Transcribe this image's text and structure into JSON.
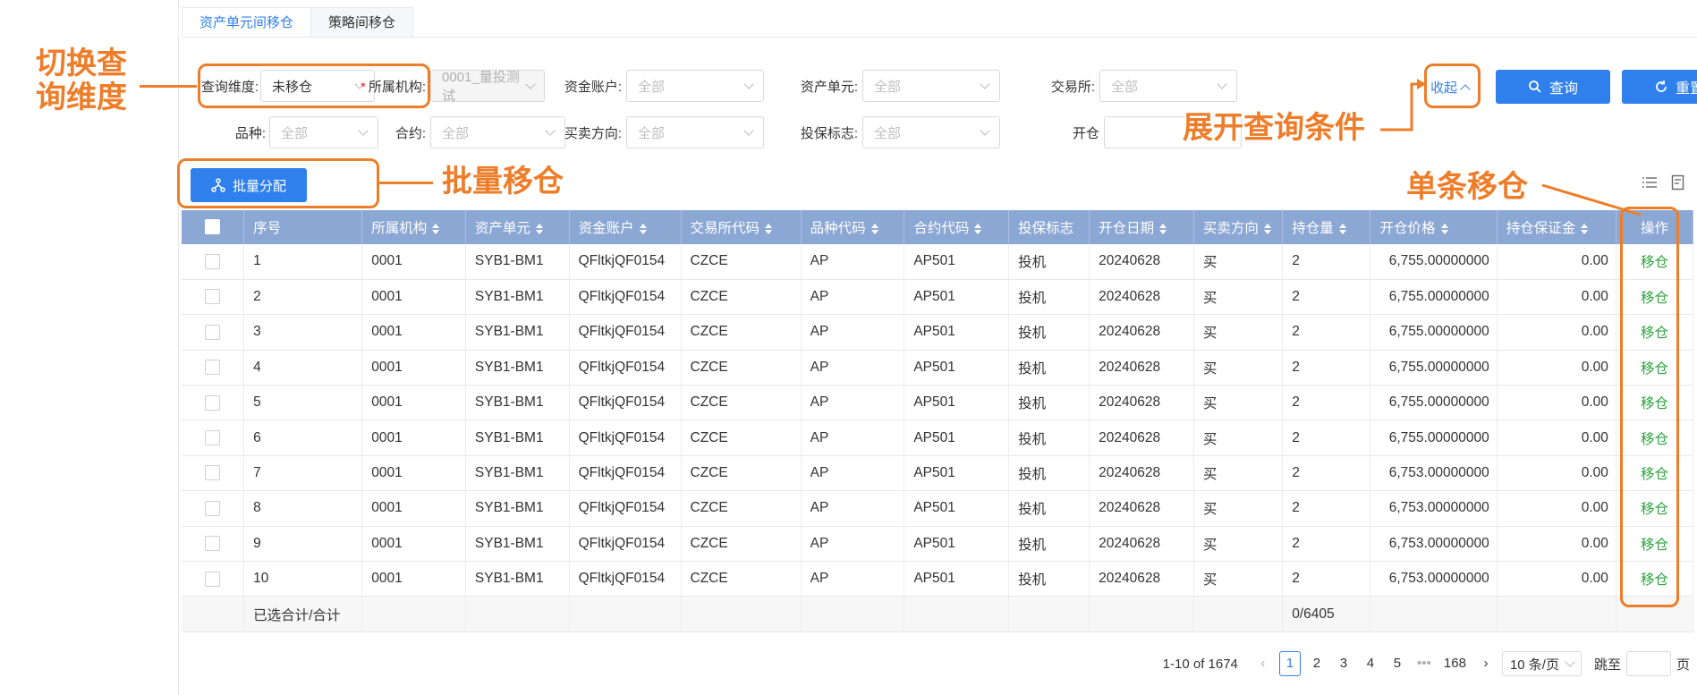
{
  "tabs": [
    {
      "label": "资产单元间移仓",
      "active": true
    },
    {
      "label": "策略间移仓",
      "active": false
    }
  ],
  "filters": {
    "query_dim": {
      "label": "查询维度:",
      "value": "未移仓"
    },
    "org": {
      "label": "所属机构:",
      "value": "0001_量投测试",
      "required": true
    },
    "fund_account": {
      "label": "资金账户:",
      "placeholder": "全部"
    },
    "asset_unit": {
      "label": "资产单元:",
      "placeholder": "全部"
    },
    "exchange": {
      "label": "交易所:",
      "placeholder": "全部"
    },
    "product": {
      "label": "品种:",
      "placeholder": "全部"
    },
    "contract": {
      "label": "合约:",
      "placeholder": "全部"
    },
    "direction": {
      "label": "买卖方向:",
      "placeholder": "全部"
    },
    "hedge": {
      "label": "投保标志:",
      "placeholder": "全部"
    },
    "open_date": {
      "label": "开仓"
    }
  },
  "actions": {
    "collapse": "收起",
    "query": "查询",
    "reset": "重置",
    "batch_assign": "批量分配"
  },
  "table": {
    "columns": [
      "序号",
      "所属机构",
      "资产单元",
      "资金账户",
      "交易所代码",
      "品种代码",
      "合约代码",
      "投保标志",
      "开仓日期",
      "买卖方向",
      "持仓量",
      "开仓价格",
      "持仓保证金",
      "操作"
    ],
    "rows": [
      [
        "1",
        "0001",
        "SYB1-BM1",
        "QFltkjQF0154",
        "CZCE",
        "AP",
        "AP501",
        "投机",
        "20240628",
        "买",
        "2",
        "6,755.00000000",
        "0.00",
        "移仓"
      ],
      [
        "2",
        "0001",
        "SYB1-BM1",
        "QFltkjQF0154",
        "CZCE",
        "AP",
        "AP501",
        "投机",
        "20240628",
        "买",
        "2",
        "6,755.00000000",
        "0.00",
        "移仓"
      ],
      [
        "3",
        "0001",
        "SYB1-BM1",
        "QFltkjQF0154",
        "CZCE",
        "AP",
        "AP501",
        "投机",
        "20240628",
        "买",
        "2",
        "6,755.00000000",
        "0.00",
        "移仓"
      ],
      [
        "4",
        "0001",
        "SYB1-BM1",
        "QFltkjQF0154",
        "CZCE",
        "AP",
        "AP501",
        "投机",
        "20240628",
        "买",
        "2",
        "6,755.00000000",
        "0.00",
        "移仓"
      ],
      [
        "5",
        "0001",
        "SYB1-BM1",
        "QFltkjQF0154",
        "CZCE",
        "AP",
        "AP501",
        "投机",
        "20240628",
        "买",
        "2",
        "6,755.00000000",
        "0.00",
        "移仓"
      ],
      [
        "6",
        "0001",
        "SYB1-BM1",
        "QFltkjQF0154",
        "CZCE",
        "AP",
        "AP501",
        "投机",
        "20240628",
        "买",
        "2",
        "6,755.00000000",
        "0.00",
        "移仓"
      ],
      [
        "7",
        "0001",
        "SYB1-BM1",
        "QFltkjQF0154",
        "CZCE",
        "AP",
        "AP501",
        "投机",
        "20240628",
        "买",
        "2",
        "6,753.00000000",
        "0.00",
        "移仓"
      ],
      [
        "8",
        "0001",
        "SYB1-BM1",
        "QFltkjQF0154",
        "CZCE",
        "AP",
        "AP501",
        "投机",
        "20240628",
        "买",
        "2",
        "6,753.00000000",
        "0.00",
        "移仓"
      ],
      [
        "9",
        "0001",
        "SYB1-BM1",
        "QFltkjQF0154",
        "CZCE",
        "AP",
        "AP501",
        "投机",
        "20240628",
        "买",
        "2",
        "6,753.00000000",
        "0.00",
        "移仓"
      ],
      [
        "10",
        "0001",
        "SYB1-BM1",
        "QFltkjQF0154",
        "CZCE",
        "AP",
        "AP501",
        "投机",
        "20240628",
        "买",
        "2",
        "6,753.00000000",
        "0.00",
        "移仓"
      ]
    ],
    "summary": {
      "label": "已选合计/合计",
      "qty": "0/6405"
    }
  },
  "pagination": {
    "total": "1-10 of 1674",
    "pages": [
      "1",
      "2",
      "3",
      "4",
      "5",
      "•••",
      "168"
    ],
    "current": "1",
    "page_size": "10 条/页",
    "jump_label": "跳至",
    "page_unit": "页"
  },
  "annotations": {
    "switch_dim": "切换查\n询维度",
    "expand": "展开查询条件",
    "batch": "批量移仓",
    "single": "单条移仓"
  },
  "colors": {
    "primary": "#2f80ed",
    "header": "#8ba7d4",
    "annotation": "#ee7d2a",
    "action": "#2aa33b"
  }
}
